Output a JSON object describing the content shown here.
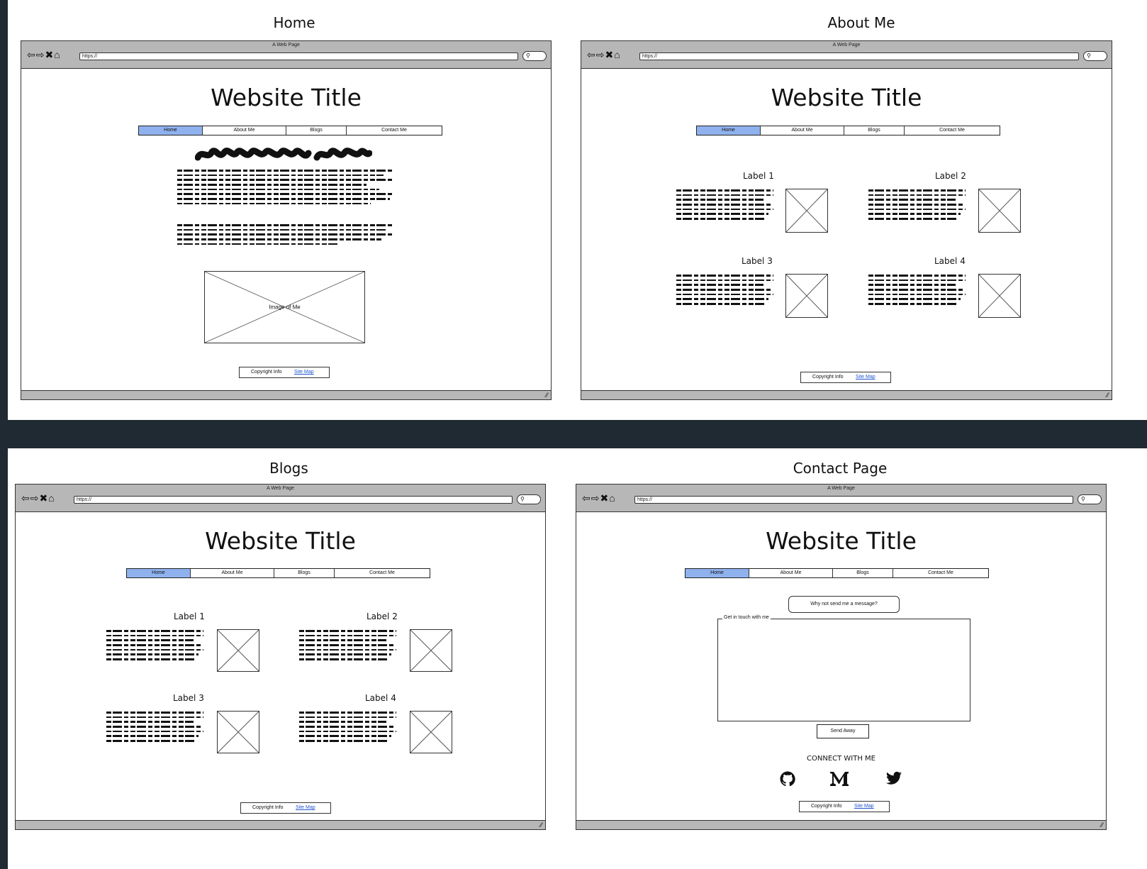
{
  "wireframes": {
    "home": {
      "caption": "Home"
    },
    "about": {
      "caption": "About Me"
    },
    "blogs": {
      "caption": "Blogs"
    },
    "contact": {
      "caption": "Contact Page"
    }
  },
  "browser": {
    "tab_title": "A Web Page",
    "url": "https://"
  },
  "site": {
    "title": "Website Title"
  },
  "nav": {
    "items": [
      "Home",
      "About Me",
      "Blogs",
      "Contact Me"
    ]
  },
  "footer": {
    "copyright": "Copyright Info",
    "sitemap": "Site Map"
  },
  "home": {
    "image_label": "Image of Me"
  },
  "cards": {
    "labels": [
      "Label 1",
      "Label 2",
      "Label 3",
      "Label 4"
    ]
  },
  "contact": {
    "bubble": "Why not send me a message?",
    "fieldset_legend": "Get in touch with me",
    "send_button": "Send Away",
    "connect_heading": "CONNECT WITH ME",
    "social_icons": [
      "github-icon",
      "medium-icon",
      "twitter-icon"
    ]
  },
  "colors": {
    "nav_active": "#8fb2ee",
    "chrome": "#b7b7b7",
    "background": "#1f2a33"
  }
}
